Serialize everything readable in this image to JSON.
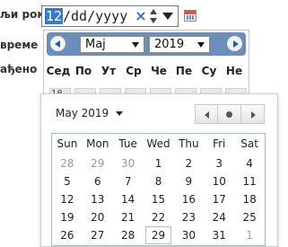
{
  "form": {
    "label1": "љи рок",
    "label2": "време",
    "label3": "ађено"
  },
  "date_input": {
    "month": "12",
    "rest": "/dd/yyyy",
    "clear": "×"
  },
  "back_picker": {
    "month": "Мај",
    "year": "2019",
    "weekdays": [
      "Сед",
      "По",
      "Ут",
      "Ср",
      "Че",
      "Пе",
      "Су",
      "Не"
    ],
    "row1": [
      "18",
      "",
      "",
      "",
      "",
      "",
      "",
      ""
    ]
  },
  "front_picker": {
    "title": "May 2019",
    "weekdays": [
      "Sun",
      "Mon",
      "Tue",
      "Wed",
      "Thu",
      "Fri",
      "Sat"
    ],
    "weeks": [
      [
        "28",
        "29",
        "30",
        "1",
        "2",
        "3",
        "4"
      ],
      [
        "5",
        "6",
        "7",
        "8",
        "9",
        "10",
        "11"
      ],
      [
        "12",
        "13",
        "14",
        "15",
        "16",
        "17",
        "18"
      ],
      [
        "19",
        "20",
        "21",
        "22",
        "23",
        "24",
        "25"
      ],
      [
        "26",
        "27",
        "28",
        "29",
        "30",
        "31",
        "1"
      ]
    ],
    "other_month": [
      [
        0,
        0
      ],
      [
        0,
        1
      ],
      [
        0,
        2
      ],
      [
        4,
        6
      ]
    ],
    "today": [
      4,
      3
    ]
  },
  "colors": {
    "header_blue": "#6b8fb9",
    "accent_blue": "#3a79c9"
  }
}
